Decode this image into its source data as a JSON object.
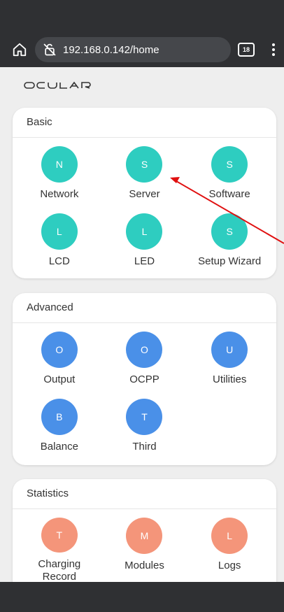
{
  "browser": {
    "url": "192.168.0.142/home",
    "tab_count": "18"
  },
  "brand": {
    "logo_text": "OCULAR"
  },
  "colors": {
    "basic": "#2ecdc0",
    "advanced": "#4a90e8",
    "statistics": "#f4957a",
    "annotation_arrow": "#e01010"
  },
  "sections": [
    {
      "title": "Basic",
      "items": [
        {
          "initial": "N",
          "label": "Network"
        },
        {
          "initial": "S",
          "label": "Server"
        },
        {
          "initial": "S",
          "label": "Software"
        },
        {
          "initial": "L",
          "label": "LCD"
        },
        {
          "initial": "L",
          "label": "LED"
        },
        {
          "initial": "S",
          "label": "Setup Wizard"
        }
      ]
    },
    {
      "title": "Advanced",
      "items": [
        {
          "initial": "O",
          "label": "Output"
        },
        {
          "initial": "O",
          "label": "OCPP"
        },
        {
          "initial": "U",
          "label": "Utilities"
        },
        {
          "initial": "B",
          "label": "Balance"
        },
        {
          "initial": "T",
          "label": "Third"
        }
      ]
    },
    {
      "title": "Statistics",
      "items": [
        {
          "initial": "T",
          "label": "Charging Record"
        },
        {
          "initial": "M",
          "label": "Modules"
        },
        {
          "initial": "L",
          "label": "Logs"
        }
      ]
    }
  ]
}
